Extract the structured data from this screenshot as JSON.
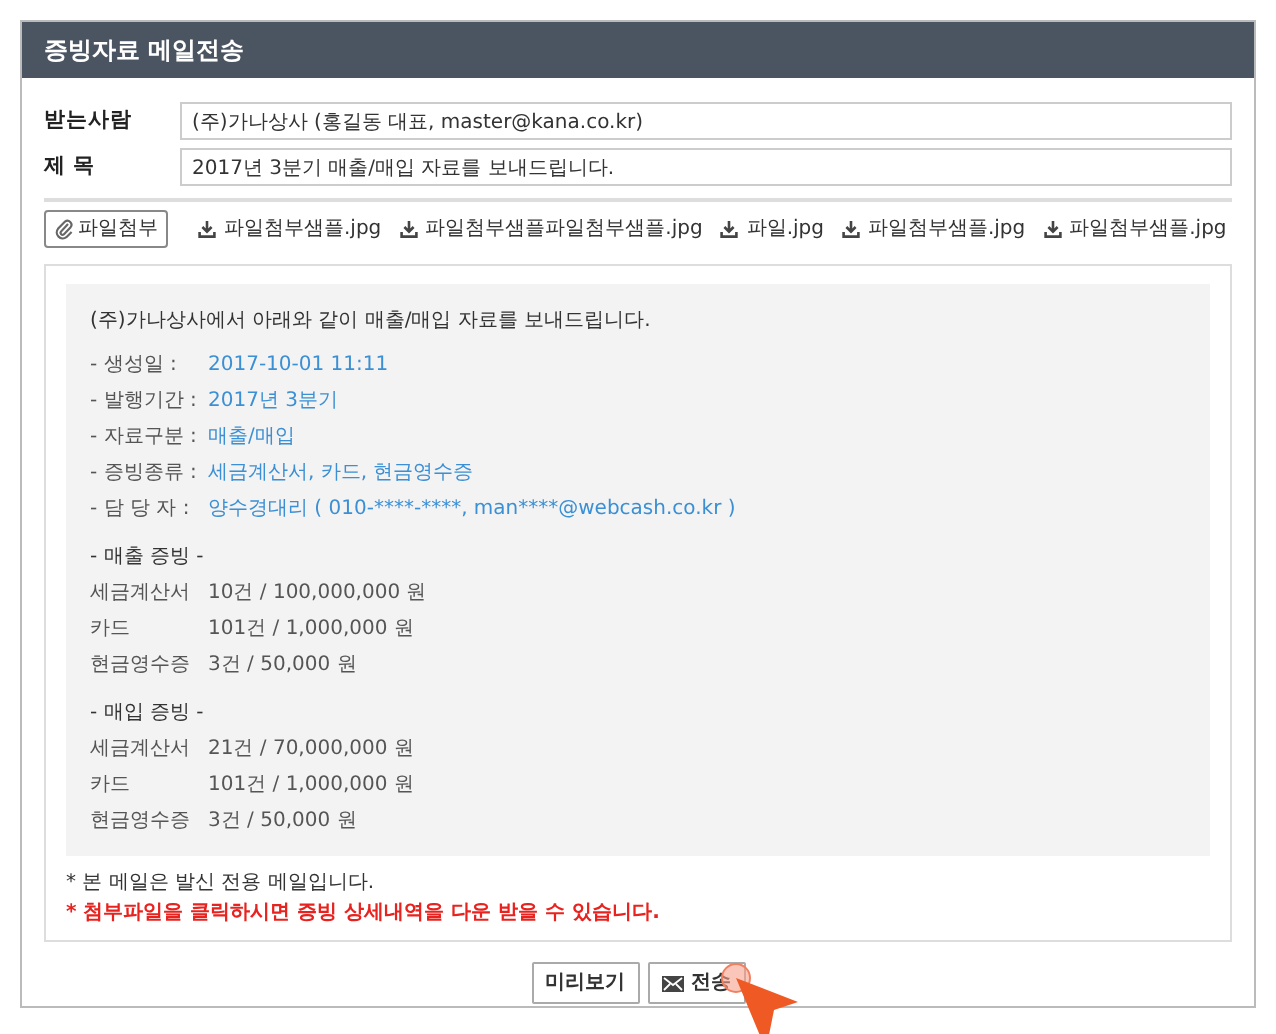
{
  "window": {
    "title": "증빙자료 메일전송"
  },
  "recipient": {
    "label": "받는사람",
    "value": "(주)가나상사 (홍길동 대표, master@kana.co.kr)"
  },
  "subject": {
    "label": "제 목",
    "value": "2017년 3분기 매출/매입 자료를 보내드립니다."
  },
  "attach_button": {
    "label": "파일첨부"
  },
  "attachments": [
    {
      "name": "파일첨부샘플.jpg"
    },
    {
      "name": "파일첨부샘플파일첨부샘플.jpg"
    },
    {
      "name": "파일.jpg"
    },
    {
      "name": "파일첨부샘플.jpg"
    },
    {
      "name": "파일첨부샘플.jpg"
    }
  ],
  "message": {
    "intro": "(주)가나상사에서 아래와 같이 매출/매입 자료를 보내드립니다.",
    "details": [
      {
        "label": "- 생성일 :",
        "value": "2017-10-01 11:11"
      },
      {
        "label": "- 발행기간 :",
        "value": "2017년 3분기"
      },
      {
        "label": "- 자료구분 :",
        "value": "매출/매입"
      },
      {
        "label": "- 증빙종류 :",
        "value": "세금계산서, 카드, 현금영수증"
      },
      {
        "label": "- 담 당 자 :",
        "value": "양수경대리 ( 010-****-****, man****@webcash.co.kr )"
      }
    ],
    "sections": [
      {
        "heading": "- 매출 증빙 -",
        "items": [
          {
            "label": "세금계산서",
            "value": "10건 / 100,000,000 원"
          },
          {
            "label": "카드",
            "value": "101건 / 1,000,000 원"
          },
          {
            "label": "현금영수증",
            "value": "3건 / 50,000 원"
          }
        ]
      },
      {
        "heading": "- 매입 증빙 -",
        "items": [
          {
            "label": "세금계산서",
            "value": "21건 / 70,000,000 원"
          },
          {
            "label": "카드",
            "value": "101건 / 1,000,000 원"
          },
          {
            "label": "현금영수증",
            "value": "3건 / 50,000 원"
          }
        ]
      }
    ]
  },
  "notes": [
    {
      "text": "* 본 메일은 발신 전용 메일입니다.",
      "kind": "normal"
    },
    {
      "text": "* 첨부파일을 클릭하시면 증빙 상세내역을 다운 받을 수 있습니다.",
      "kind": "warning"
    }
  ],
  "buttons": [
    {
      "label": "미리보기",
      "kind": "plain"
    },
    {
      "label": "전송",
      "kind": "mail"
    }
  ]
}
